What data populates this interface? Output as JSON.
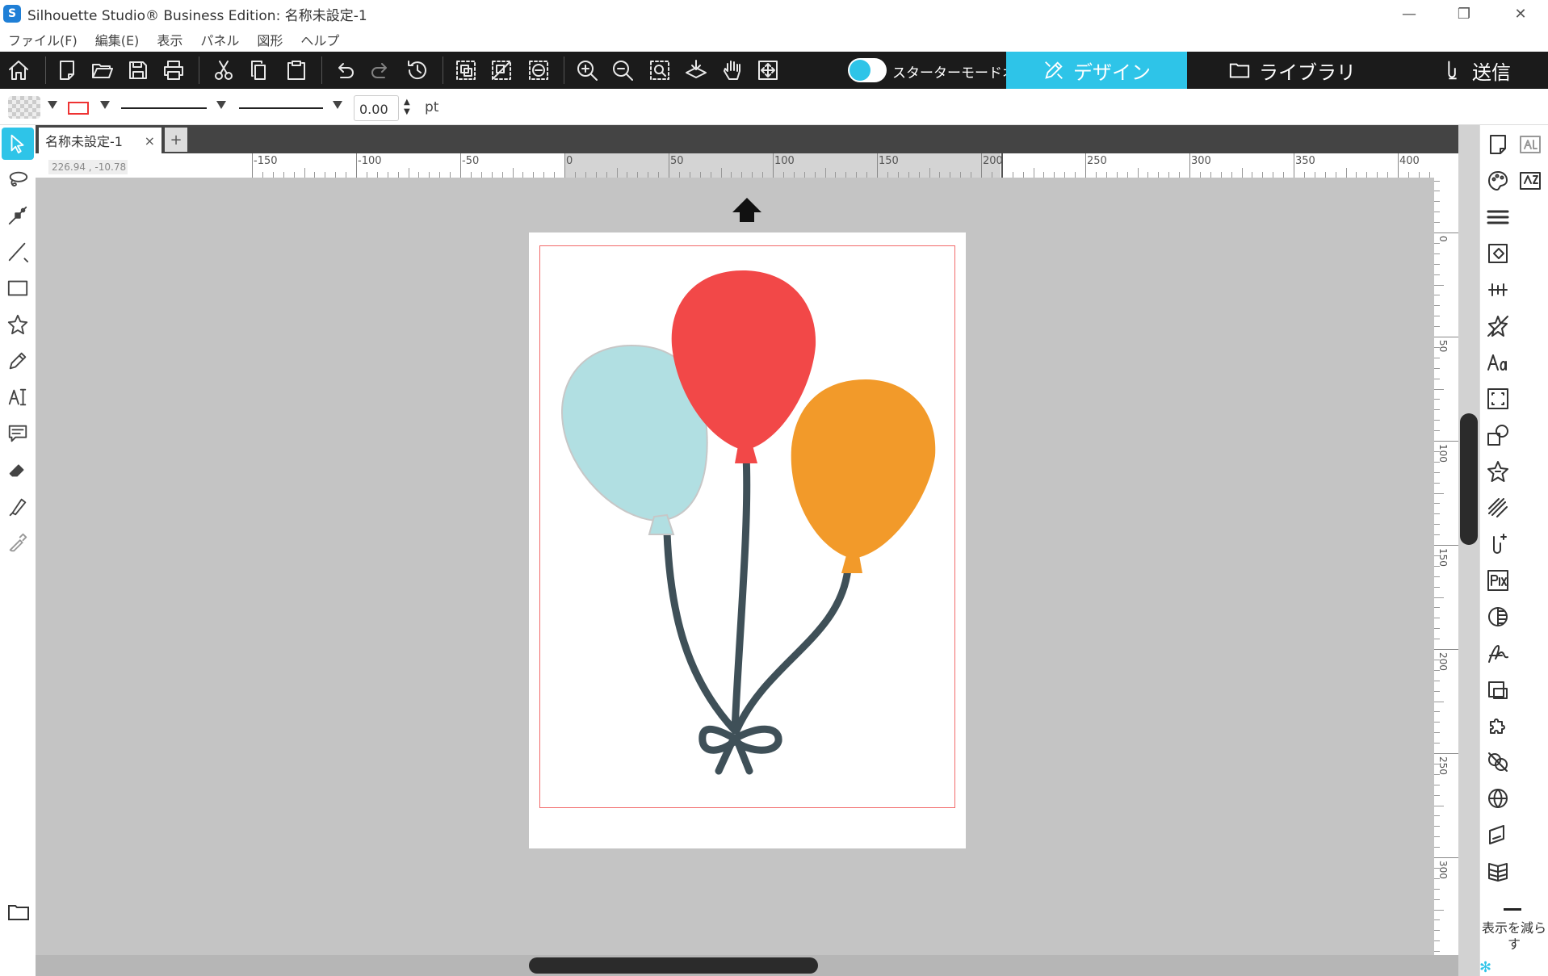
{
  "window": {
    "title": "Silhouette Studio® Business Edition: 名称未設定-1",
    "minimize": "—",
    "restore": "❐",
    "close": "✕"
  },
  "app_logo_letter": "S",
  "menu": [
    "ファイル(F)",
    "編集(E)",
    "表示",
    "パネル",
    "図形",
    "ヘルプ"
  ],
  "toolbar": {
    "starter_mode_label": "スターターモードオフ",
    "tabs": {
      "design": "デザイン",
      "library": "ライブラリ",
      "send": "送信"
    }
  },
  "properties": {
    "line_width": "0.00",
    "unit": "pt"
  },
  "document_tab": {
    "name": "名称未設定-1",
    "close": "×",
    "add": "+"
  },
  "ruler": {
    "coords": "226.94 , -10.78",
    "h_labels": [
      "-150",
      "-100",
      "-50",
      "0",
      "50",
      "100",
      "150",
      "200",
      "250",
      "300",
      "350",
      "400"
    ],
    "v_labels": [
      "0",
      "50",
      "100",
      "150",
      "200",
      "250",
      "300"
    ]
  },
  "right_panel": {
    "collapse_label": "表示を減らす"
  },
  "colors": {
    "accent": "#2ec4e8",
    "toolbar_bg": "#1b1b1b",
    "canvas_bg": "#c4c4c4",
    "cut_border": "#f26a6a",
    "balloon_blue": "#b1dfe2",
    "balloon_red": "#f24848",
    "balloon_orange": "#f29a2a",
    "string": "#3f5058"
  }
}
